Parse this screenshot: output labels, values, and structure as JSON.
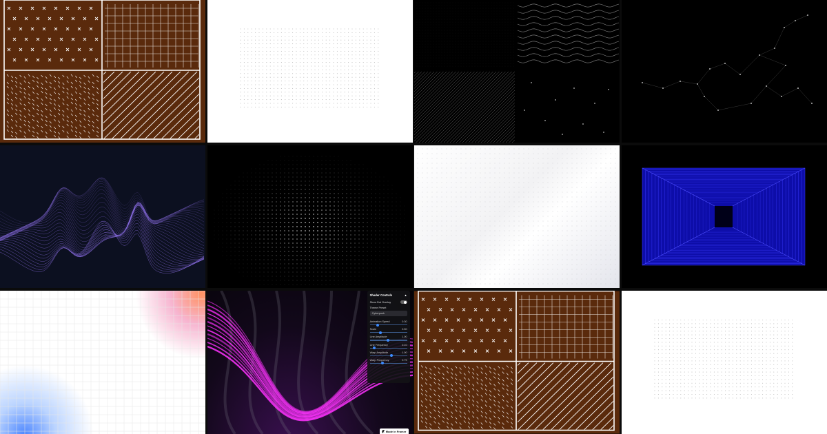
{
  "colors": {
    "brown": "#5a2a0c",
    "white": "#ffffff",
    "black": "#000000",
    "navy": "#0c1020",
    "blue": "#1010c8",
    "magenta": "#ff33ff"
  },
  "shader_panel": {
    "title": "Shader Controls",
    "collapse_glyph": "▲",
    "toggle_label": "Show Dot Overlay",
    "theme_label": "Theme Preset",
    "theme_value": "Cyberpunk",
    "sliders": [
      {
        "label": "Animation Speed",
        "value": "0.30",
        "fraction": 0.18
      },
      {
        "label": "Scale",
        "value": "0.50",
        "fraction": 0.25
      },
      {
        "label": "Line Amplitude",
        "value": "1.00",
        "fraction": 0.45
      },
      {
        "label": "Line Frequency",
        "value": "0.10",
        "fraction": 0.08
      },
      {
        "label": "Warp Amplitude",
        "value": "1.00",
        "fraction": 0.55
      },
      {
        "label": "Warp Frequency",
        "value": "0.75",
        "fraction": 0.3
      }
    ]
  },
  "framer_badge": "Made in Framer",
  "icons": {
    "framer_logo": "framer-logo-icon"
  }
}
